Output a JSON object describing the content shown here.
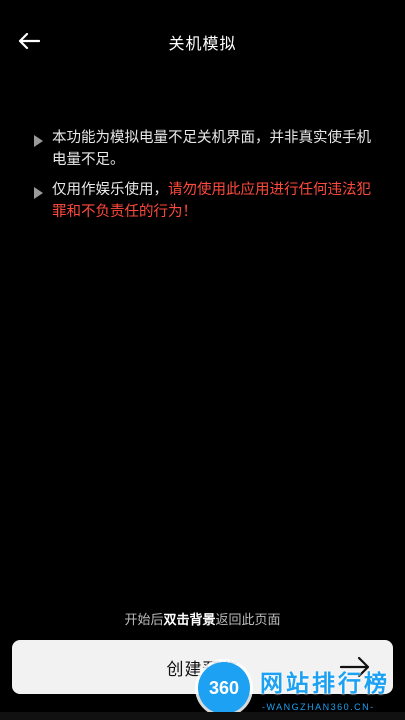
{
  "header": {
    "title": "关机模拟"
  },
  "notice": {
    "item1": "本功能为模拟电量不足关机界面，并非真实使手机电量不足。",
    "item2_normal": "仅用作娱乐使用，",
    "item2_warning": "请勿使用此应用进行任何违法犯罪和不负责任的行为！"
  },
  "hint": {
    "prefix": "开始后",
    "bold": "双击背景",
    "suffix": "返回此页面"
  },
  "create_button": {
    "label": "创建预览"
  },
  "watermark": {
    "badge": "360",
    "title": "网站排行榜",
    "subtitle": "-WANGZHAN360.CN-"
  },
  "colors": {
    "warning": "#ff4a3d",
    "watermark": "#1da1f2"
  }
}
